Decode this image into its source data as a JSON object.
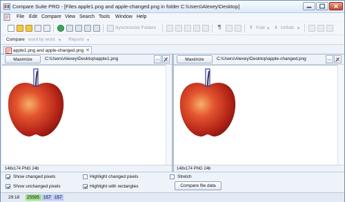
{
  "window": {
    "title": "Compare Suite PRO - [Files apple1.png and apple-changed.png in folder C:\\Users\\Alexey\\Desktop]",
    "icon": "app-compare-icon"
  },
  "menubar": {
    "items": [
      "File",
      "Edit",
      "Compare",
      "View",
      "Search",
      "Tools",
      "Window",
      "Help"
    ]
  },
  "toolbar": {
    "sync_label": "Synchronize Folders",
    "fold_label": "Fold",
    "unfold_label": "Unfold",
    "paragraph_glyph": "¶"
  },
  "compare_bar": {
    "compare_label": "Compare",
    "mode_label": "word by word",
    "reports_label": "Reports"
  },
  "tab": {
    "label": "apple1.png and apple-changed.png",
    "close": "✕"
  },
  "left_pane": {
    "maximize_label": "Maximize",
    "path": "C:\\Users\\Alexey\\Desktop\\apple1.png",
    "browse_label": "...",
    "info": "148x174 PNG 24b"
  },
  "right_pane": {
    "maximize_label": "Maximize",
    "path": "C:\\Users\\Alexey\\Desktop\\apple-changed.png",
    "browse_label": "...",
    "info": "148x174 PNG 24b"
  },
  "options": {
    "show_changed": "Show changed pixels",
    "show_unchanged": "Show unchanged pixels",
    "highlight_changed": "Highlight changed pixels",
    "highlight_rectangles": "Highlight with rectangles",
    "stretch": "Stretch",
    "compare_button": "Compare file data"
  },
  "statusbar": {
    "position": "29:18",
    "count_green": "25595",
    "count_blue1": "157",
    "count_blue2": "157"
  },
  "colors": {
    "accent": "#2a5aa8",
    "highlight_rect": "#1f3fd6",
    "status_green": "#9fe08a",
    "status_blue": "#b9c6f5"
  }
}
